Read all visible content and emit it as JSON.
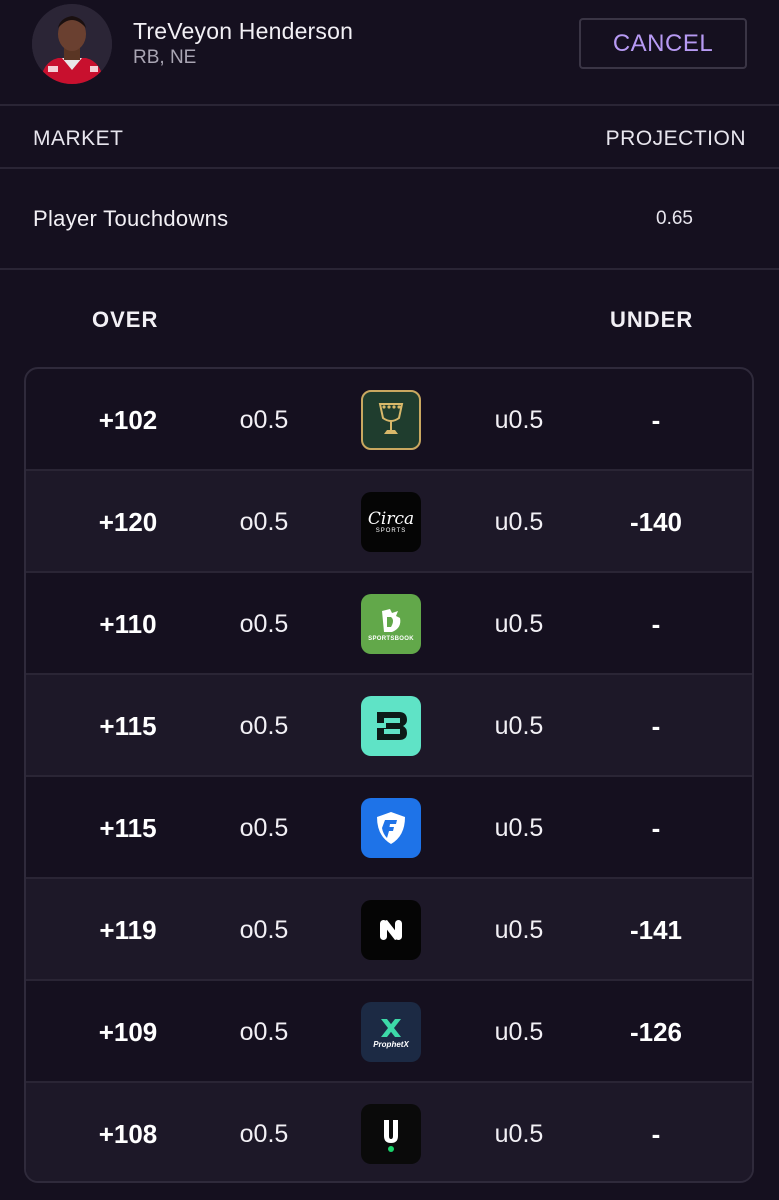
{
  "player": {
    "name": "TreVeyon Henderson",
    "meta": "RB, NE"
  },
  "header": {
    "cancel_label": "CANCEL"
  },
  "market_table": {
    "market_header": "MARKET",
    "projection_header": "PROJECTION",
    "market_name": "Player Touchdowns",
    "projection_value": "0.65"
  },
  "columns": {
    "over": "OVER",
    "under": "UNDER"
  },
  "rows": [
    {
      "over_price": "+102",
      "over_line": "o0.5",
      "book": "golden-chalice-book-icon",
      "under_line": "u0.5",
      "under_price": "-"
    },
    {
      "over_price": "+120",
      "over_line": "o0.5",
      "book": "circa-sports-icon",
      "under_line": "u0.5",
      "under_price": "-140"
    },
    {
      "over_price": "+110",
      "over_line": "o0.5",
      "book": "draftkings-sportsbook-icon",
      "under_line": "u0.5",
      "under_price": "-"
    },
    {
      "over_price": "+115",
      "over_line": "o0.5",
      "book": "betr-b-icon",
      "under_line": "u0.5",
      "under_price": "-"
    },
    {
      "over_price": "+115",
      "over_line": "o0.5",
      "book": "fanduel-shield-icon",
      "under_line": "u0.5",
      "under_price": "-"
    },
    {
      "over_price": "+119",
      "over_line": "o0.5",
      "book": "novig-n-icon",
      "under_line": "u0.5",
      "under_price": "-141"
    },
    {
      "over_price": "+109",
      "over_line": "o0.5",
      "book": "prophetx-icon",
      "under_line": "u0.5",
      "under_price": "-126"
    },
    {
      "over_price": "+108",
      "over_line": "o0.5",
      "book": "underdog-u-icon",
      "under_line": "u0.5",
      "under_price": "-"
    }
  ],
  "logo_text": {
    "circa": "Circa",
    "circa_sub": "SPORTS",
    "draftkings": "SPORTSBOOK",
    "prophetx": "ProphetX"
  },
  "colors": {
    "background": "#15101f",
    "accent": "#b79af3",
    "row_alt": "#1d1828"
  }
}
